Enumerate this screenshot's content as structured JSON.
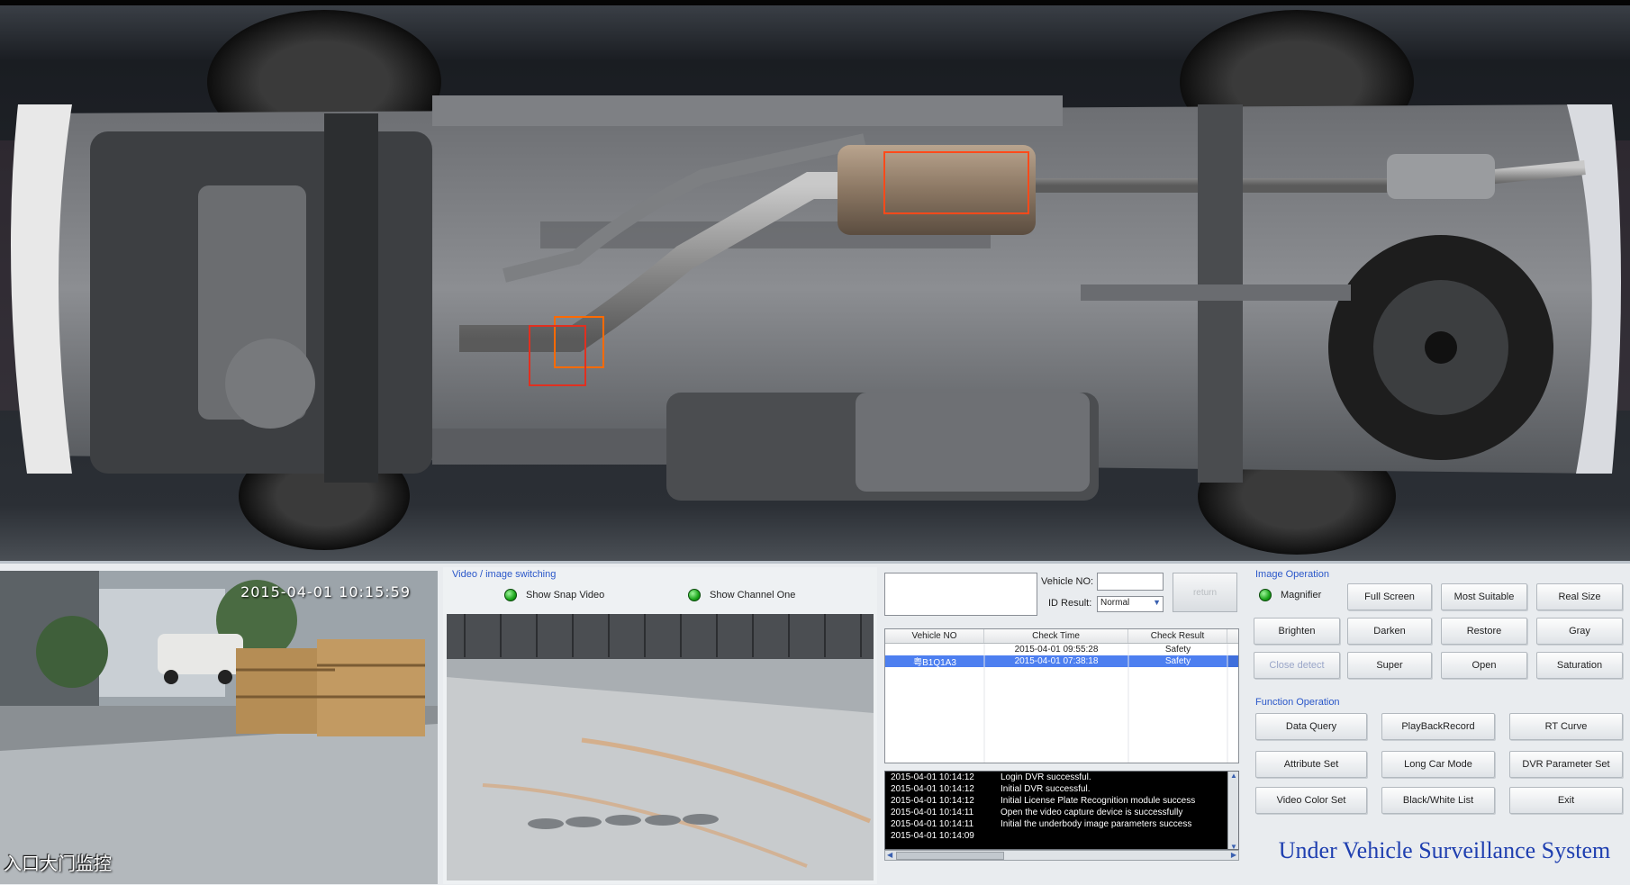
{
  "scan": {
    "detections": [
      {
        "color": "#ff4a1a"
      },
      {
        "color": "#ff6a00"
      },
      {
        "color": "#e03020"
      }
    ]
  },
  "left_camera": {
    "timestamp": "2015-04-01 10:15:59",
    "label": "入口大门监控"
  },
  "video_switch": {
    "title": "Video / image switching",
    "show_snap_video": "Show Snap Video",
    "show_channel_one": "Show Channel One"
  },
  "vehicle_panel": {
    "vehicle_no_label": "Vehicle NO:",
    "vehicle_no_value": "",
    "id_result_label": "ID Result:",
    "id_result_value": "Normal",
    "return_button": "return",
    "columns": [
      "Vehicle NO",
      "Check Time",
      "Check Result"
    ],
    "rows": [
      {
        "vehicle_no": "",
        "check_time": "2015-04-01 09:55:28",
        "check_result": "Safety",
        "selected": false
      },
      {
        "vehicle_no": "粤B1Q1A3",
        "check_time": "2015-04-01 07:38:18",
        "check_result": "Safety",
        "selected": true
      }
    ],
    "log": [
      {
        "time": "2015-04-01 10:14:12",
        "msg": "Login DVR successful."
      },
      {
        "time": "2015-04-01 10:14:12",
        "msg": "Initial DVR successful."
      },
      {
        "time": "2015-04-01 10:14:12",
        "msg": "Initial License Plate Recognition module success"
      },
      {
        "time": "2015-04-01 10:14:11",
        "msg": "Open the video capture device is successfully"
      },
      {
        "time": "2015-04-01 10:14:11",
        "msg": "Initial the underbody image parameters success"
      },
      {
        "time": "2015-04-01 10:14:09",
        "msg": ""
      }
    ]
  },
  "image_operation": {
    "title": "Image Operation",
    "magnifier": "Magnifier",
    "full_screen": "Full Screen",
    "most_suitable": "Most Suitable",
    "real_size": "Real Size",
    "brighten": "Brighten",
    "darken": "Darken",
    "restore": "Restore",
    "gray": "Gray",
    "close_detect": "Close detect",
    "super": "Super",
    "open": "Open",
    "saturation": "Saturation"
  },
  "function_operation": {
    "title": "Function Operation",
    "data_query": "Data Query",
    "playback_record": "PlayBackRecord",
    "rt_curve": "RT Curve",
    "attribute_set": "Attribute Set",
    "long_car_mode": "Long Car Mode",
    "dvr_parameter_set": "DVR Parameter Set",
    "video_color_set": "Video Color Set",
    "black_white_list": "Black/White List",
    "exit": "Exit"
  },
  "system_title": "Under Vehicle Surveillance System"
}
